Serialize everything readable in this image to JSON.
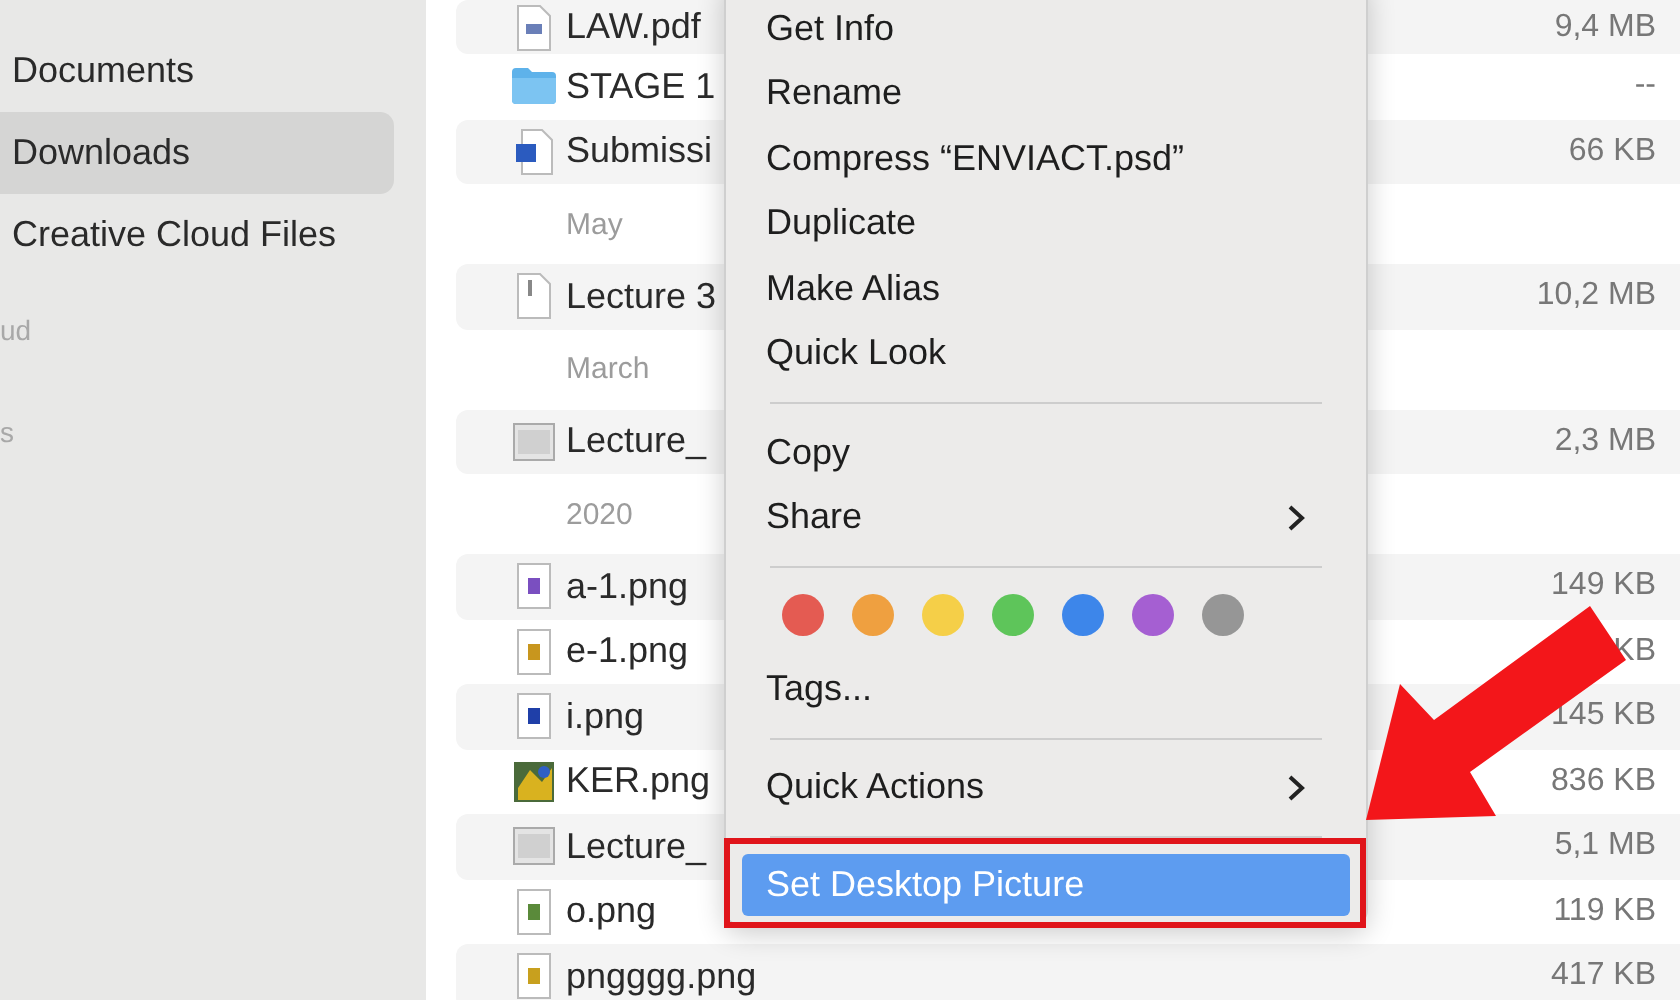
{
  "sidebar": {
    "items": [
      {
        "kind": "item",
        "label": "Documents",
        "selected": false
      },
      {
        "kind": "item",
        "label": "Downloads",
        "selected": true
      },
      {
        "kind": "item",
        "label": "Creative Cloud Files",
        "selected": false
      },
      {
        "kind": "header",
        "label": "ud"
      },
      {
        "kind": "header",
        "label": "s"
      }
    ]
  },
  "file_list": {
    "groups": [
      {
        "files": [
          {
            "name": "LAW.pdf",
            "size": "9,4 MB",
            "kind": "pdf"
          },
          {
            "name": "STAGE 1",
            "size": "--",
            "kind": "folder"
          },
          {
            "name": "Submissi",
            "size": "66 KB",
            "kind": "word"
          }
        ]
      },
      {
        "heading": "May",
        "files": [
          {
            "name": "Lecture 3",
            "size": "10,2 MB",
            "kind": "doc"
          }
        ]
      },
      {
        "heading": "March",
        "files": [
          {
            "name": "Lecture_",
            "size": "2,3 MB",
            "kind": "slide"
          }
        ]
      },
      {
        "heading": "2020",
        "files": [
          {
            "name": "a-1.png",
            "size": "149 KB",
            "kind": "image",
            "color": "#7a4fc0"
          },
          {
            "name": "e-1.png",
            "size": "KB",
            "kind": "image",
            "color": "#c8961e"
          },
          {
            "name": "i.png",
            "size": "145 KB",
            "kind": "image",
            "color": "#1f3fa8"
          },
          {
            "name": "KER.png",
            "size": "836 KB",
            "kind": "photo"
          },
          {
            "name": "Lecture_",
            "size": "5,1 MB",
            "kind": "slide"
          },
          {
            "name": "o.png",
            "size": "119 KB",
            "kind": "image",
            "color": "#5a8a3a"
          },
          {
            "name": "pngggg.png",
            "size": "417 KB",
            "kind": "image",
            "color": "#c8a01e"
          }
        ]
      }
    ]
  },
  "context_menu": {
    "items": [
      {
        "kind": "item",
        "label": "Get Info",
        "selected": false
      },
      {
        "kind": "item",
        "label": "Rename",
        "selected": false
      },
      {
        "kind": "item",
        "label": "Compress “ENVIACT.psd”",
        "selected": false
      },
      {
        "kind": "item",
        "label": "Duplicate",
        "selected": false
      },
      {
        "kind": "item",
        "label": "Make Alias",
        "selected": false
      },
      {
        "kind": "item",
        "label": "Quick Look",
        "selected": false
      },
      {
        "kind": "separator"
      },
      {
        "kind": "item",
        "label": "Copy",
        "selected": false
      },
      {
        "kind": "submenu",
        "label": "Share",
        "selected": false
      },
      {
        "kind": "separator"
      },
      {
        "kind": "tags",
        "tags": [
          {
            "color": "#e45b52"
          },
          {
            "color": "#efa040"
          },
          {
            "color": "#f5cf48"
          },
          {
            "color": "#5ec55a"
          },
          {
            "color": "#3d86ea"
          },
          {
            "color": "#a55fd2"
          },
          {
            "color": "#969696"
          }
        ]
      },
      {
        "kind": "item",
        "label": "Tags...",
        "selected": false
      },
      {
        "kind": "separator"
      },
      {
        "kind": "submenu",
        "label": "Quick Actions",
        "selected": false
      },
      {
        "kind": "separator"
      },
      {
        "kind": "item",
        "label": "Set Desktop Picture",
        "selected": true
      }
    ]
  }
}
